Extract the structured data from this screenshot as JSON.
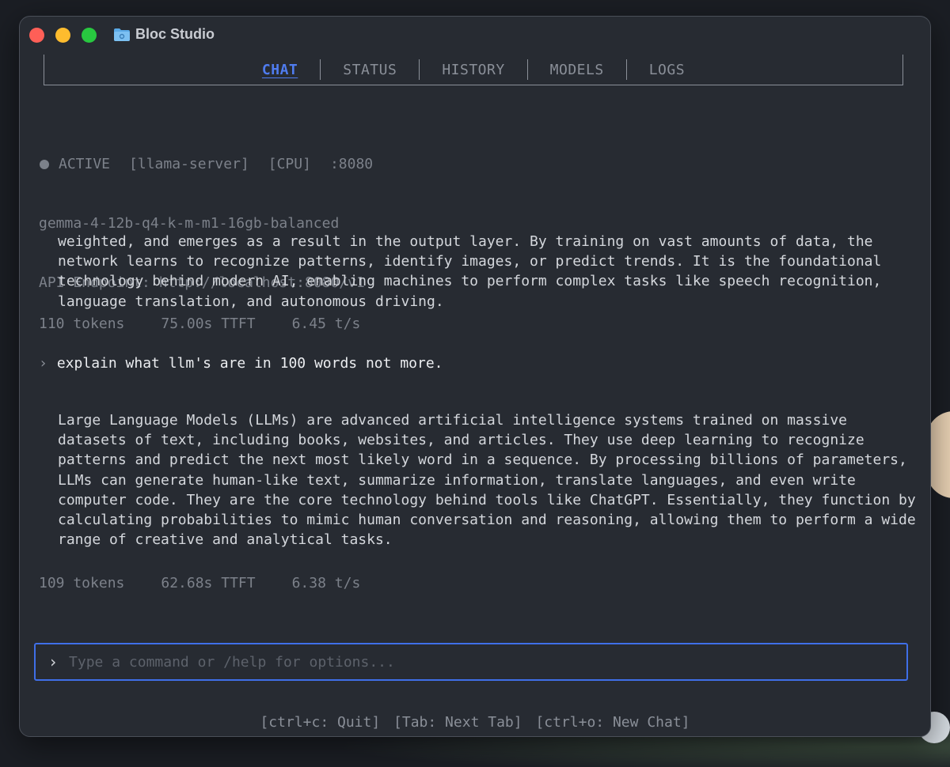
{
  "window": {
    "title": "Bloc Studio"
  },
  "tabs": [
    {
      "label": "CHAT",
      "active": true
    },
    {
      "label": "STATUS",
      "active": false
    },
    {
      "label": "HISTORY",
      "active": false
    },
    {
      "label": "MODELS",
      "active": false
    },
    {
      "label": "LOGS",
      "active": false
    }
  ],
  "server_status": {
    "state": "ACTIVE",
    "backend": "[llama-server]",
    "device": "[CPU]",
    "port": ":8080",
    "model": "gemma-4-12b-q4-k-m-m1-16gb-balanced",
    "endpoint": "API Endpoint: http://localhost:8080/v1"
  },
  "conversation": {
    "previous_response": "weighted, and emerges as a result in the output layer. By training on vast amounts of data, the network learns to recognize patterns, identify images, or predict trends. It is the foundational technology behind modern AI, enabling machines to perform complex tasks like speech recognition, language translation, and autonomous driving.",
    "previous_stats": {
      "tokens": "110 tokens",
      "ttft": "75.00s TTFT",
      "rate": "6.45 t/s"
    },
    "user_message": "explain what llm's are in 100 words not more.",
    "response": "Large Language Models (LLMs) are advanced artificial intelligence systems trained on massive datasets of text, including books, websites, and articles. They use deep learning to recognize patterns and predict the next most likely word in a sequence. By processing billions of parameters, LLMs can generate human-like text, summarize information, translate languages, and even write computer code. They are the core technology behind tools like ChatGPT. Essentially, they function by calculating probabilities to mimic human conversation and reasoning, allowing them to perform a wide range of creative and analytical tasks.",
    "response_stats": {
      "tokens": "109 tokens",
      "ttft": "62.68s TTFT",
      "rate": "6.38 t/s"
    }
  },
  "input": {
    "prompt_symbol": "›",
    "placeholder": "Type a command or /help for options...",
    "value": ""
  },
  "shortcuts": [
    "[ctrl+c: Quit]",
    "[Tab: Next Tab]",
    "[ctrl+o: New Chat]"
  ],
  "colors": {
    "window_bg": "#272b32",
    "accent": "#3f6fe8",
    "active_tab": "#4f7cf0",
    "muted_text": "#7c818a",
    "body_text": "#d4d7dc"
  }
}
